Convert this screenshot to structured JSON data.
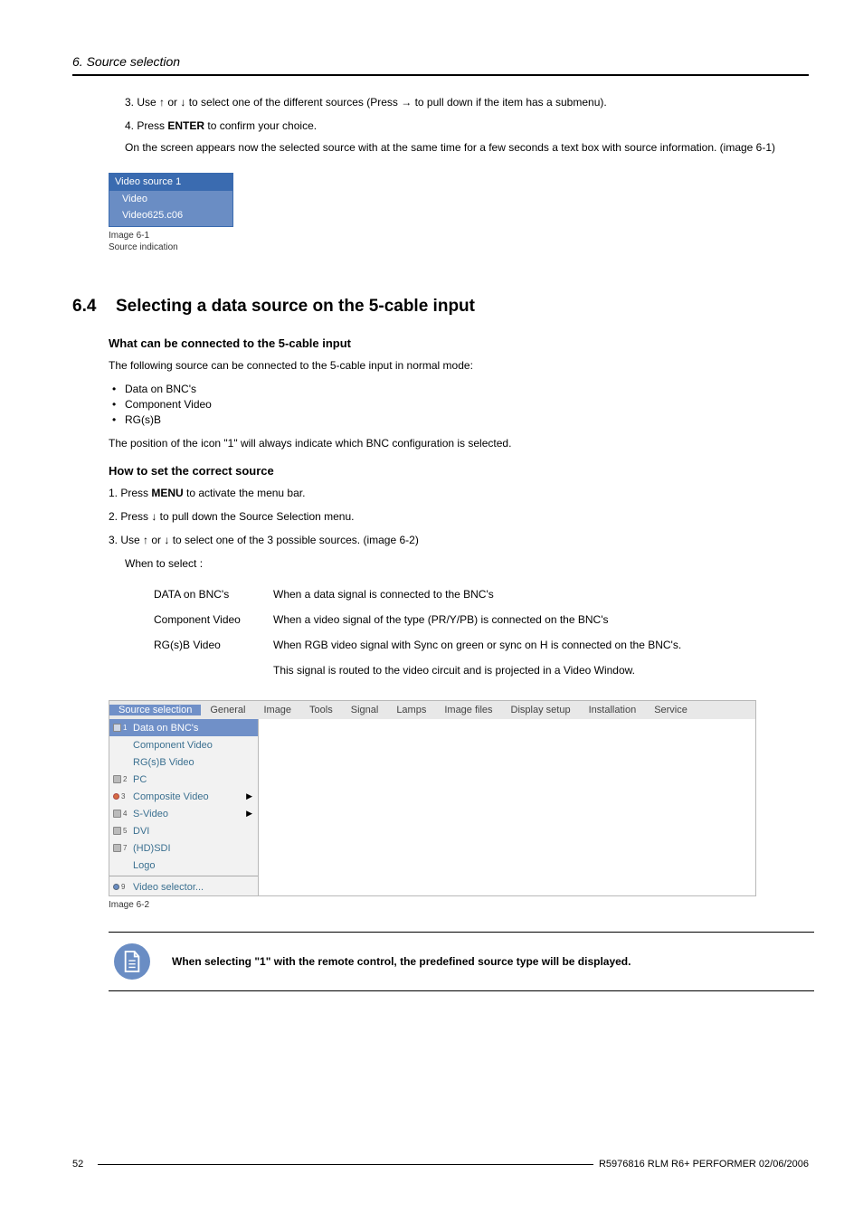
{
  "header": {
    "title": "6.  Source selection"
  },
  "intro_list": {
    "i3": "3.  Use ↑ or ↓ to select one of the different sources (Press → to pull down if the item has a submenu).",
    "i4a": "4.  Press ",
    "i4b": "ENTER",
    "i4c": " to confirm your choice.",
    "i4_sub": "On the screen appears now the selected source with at the same time for a few seconds a text box with source information. (image 6-1)"
  },
  "diagram": {
    "header": "Video source 1",
    "line1": "Video",
    "line2": "Video625.c06",
    "cap1": "Image 6-1",
    "cap2": "Source indication"
  },
  "h64": {
    "num": "6.4",
    "title": "Selecting a data source on the 5-cable input"
  },
  "what": {
    "head": "What can be connected to the 5-cable input",
    "intro": "The following source can be connected to the 5-cable input in normal mode:",
    "b1": "Data on BNC's",
    "b2": "Component Video",
    "b3": "RG(s)B",
    "after": "The position of the icon \"1\" will always indicate which BNC configuration is selected."
  },
  "how": {
    "head": "How to set the correct source",
    "s1a": "1.  Press ",
    "s1b": "MENU",
    "s1c": " to activate the menu bar.",
    "s2": "2.  Press ↓ to pull down the Source Selection menu.",
    "s3": "3.  Use ↑ or ↓ to select one of the 3 possible sources.  (image 6-2)",
    "when": "When to select :"
  },
  "table": {
    "r1c1": "DATA on BNC's",
    "r1c2": "When a data signal is connected to the BNC's",
    "r2c1": "Component Video",
    "r2c2": "When a video signal of the type (PR/Y/PB) is connected on the BNC's",
    "r3c1": "RG(s)B Video",
    "r3c2": "When RGB video signal with Sync on green or sync on H is connected on the BNC's.",
    "r4c2": "This signal is routed to the video circuit and is projected in a Video Window."
  },
  "menu": {
    "items": [
      "Source selection",
      "General",
      "Image",
      "Tools",
      "Signal",
      "Lamps",
      "Image files",
      "Display setup",
      "Installation",
      "Service"
    ],
    "dd": {
      "data_on_bnc": "Data on BNC's",
      "component": "Component Video",
      "rgsb": "RG(s)B Video",
      "pc": "PC",
      "composite": "Composite Video",
      "svideo": "S-Video",
      "dvi": "DVI",
      "hdsdi": "(HD)SDI",
      "logo": "Logo",
      "vidsel": "Video selector..."
    },
    "cap": "Image 6-2"
  },
  "note": {
    "text": "When selecting \"1\" with the remote control, the predefined source type will be displayed."
  },
  "footer": {
    "page": "52",
    "doc": "R5976816  RLM R6+ PERFORMER  02/06/2006"
  }
}
